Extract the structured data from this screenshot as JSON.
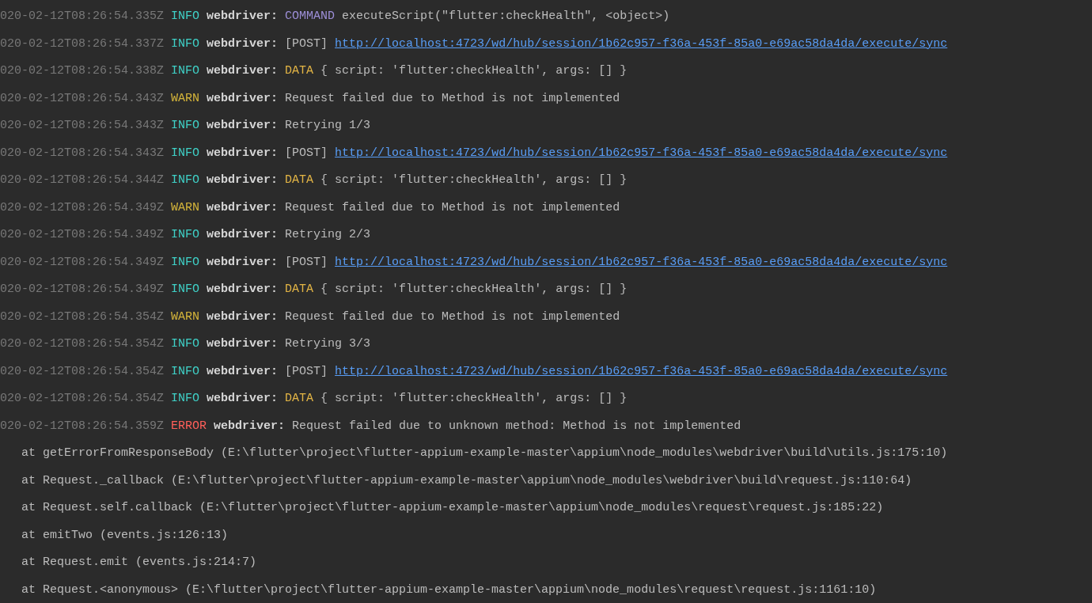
{
  "console": {
    "lines": [
      {
        "kind": "info",
        "timestamp": "020-02-12T08:26:54.335Z",
        "severity": "INFO",
        "source": "webdriver:",
        "message": [
          {
            "kind": "command",
            "text": "COMMAND"
          },
          {
            "kind": "text",
            "text": "executeScript(\"flutter:checkHealth\", <object>)"
          }
        ]
      },
      {
        "kind": "info",
        "timestamp": "020-02-12T08:26:54.337Z",
        "severity": "INFO",
        "source": "webdriver:",
        "message": [
          {
            "kind": "text",
            "text": "[POST]"
          },
          {
            "kind": "link",
            "text": "http://localhost:4723/wd/hub/session/1b62c957-f36a-453f-85a0-e69ac58da4da/execute/sync"
          }
        ]
      },
      {
        "kind": "info",
        "timestamp": "020-02-12T08:26:54.338Z",
        "severity": "INFO",
        "source": "webdriver:",
        "message": [
          {
            "kind": "data",
            "text": "DATA"
          },
          {
            "kind": "text",
            "text": "{ script: 'flutter:checkHealth', args: [] }"
          }
        ]
      },
      {
        "kind": "warn",
        "timestamp": "020-02-12T08:26:54.343Z",
        "severity": "WARN",
        "source": "webdriver:",
        "message": [
          {
            "kind": "text",
            "text": "Request failed due to Method is not implemented"
          }
        ]
      },
      {
        "kind": "info",
        "timestamp": "020-02-12T08:26:54.343Z",
        "severity": "INFO",
        "source": "webdriver:",
        "message": [
          {
            "kind": "text",
            "text": "Retrying 1/3"
          }
        ]
      },
      {
        "kind": "info",
        "timestamp": "020-02-12T08:26:54.343Z",
        "severity": "INFO",
        "source": "webdriver:",
        "message": [
          {
            "kind": "text",
            "text": "[POST]"
          },
          {
            "kind": "link",
            "text": "http://localhost:4723/wd/hub/session/1b62c957-f36a-453f-85a0-e69ac58da4da/execute/sync"
          }
        ]
      },
      {
        "kind": "info",
        "timestamp": "020-02-12T08:26:54.344Z",
        "severity": "INFO",
        "source": "webdriver:",
        "message": [
          {
            "kind": "data",
            "text": "DATA"
          },
          {
            "kind": "text",
            "text": "{ script: 'flutter:checkHealth', args: [] }"
          }
        ]
      },
      {
        "kind": "warn",
        "timestamp": "020-02-12T08:26:54.349Z",
        "severity": "WARN",
        "source": "webdriver:",
        "message": [
          {
            "kind": "text",
            "text": "Request failed due to Method is not implemented"
          }
        ]
      },
      {
        "kind": "info",
        "timestamp": "020-02-12T08:26:54.349Z",
        "severity": "INFO",
        "source": "webdriver:",
        "message": [
          {
            "kind": "text",
            "text": "Retrying 2/3"
          }
        ]
      },
      {
        "kind": "info",
        "timestamp": "020-02-12T08:26:54.349Z",
        "severity": "INFO",
        "source": "webdriver:",
        "message": [
          {
            "kind": "text",
            "text": "[POST]"
          },
          {
            "kind": "link",
            "text": "http://localhost:4723/wd/hub/session/1b62c957-f36a-453f-85a0-e69ac58da4da/execute/sync"
          }
        ]
      },
      {
        "kind": "info",
        "timestamp": "020-02-12T08:26:54.349Z",
        "severity": "INFO",
        "source": "webdriver:",
        "message": [
          {
            "kind": "data",
            "text": "DATA"
          },
          {
            "kind": "text",
            "text": "{ script: 'flutter:checkHealth', args: [] }"
          }
        ]
      },
      {
        "kind": "warn",
        "timestamp": "020-02-12T08:26:54.354Z",
        "severity": "WARN",
        "source": "webdriver:",
        "message": [
          {
            "kind": "text",
            "text": "Request failed due to Method is not implemented"
          }
        ]
      },
      {
        "kind": "info",
        "timestamp": "020-02-12T08:26:54.354Z",
        "severity": "INFO",
        "source": "webdriver:",
        "message": [
          {
            "kind": "text",
            "text": "Retrying 3/3"
          }
        ]
      },
      {
        "kind": "info",
        "timestamp": "020-02-12T08:26:54.354Z",
        "severity": "INFO",
        "source": "webdriver:",
        "message": [
          {
            "kind": "text",
            "text": "[POST]"
          },
          {
            "kind": "link",
            "text": "http://localhost:4723/wd/hub/session/1b62c957-f36a-453f-85a0-e69ac58da4da/execute/sync"
          }
        ]
      },
      {
        "kind": "info",
        "timestamp": "020-02-12T08:26:54.354Z",
        "severity": "INFO",
        "source": "webdriver:",
        "message": [
          {
            "kind": "data",
            "text": "DATA"
          },
          {
            "kind": "text",
            "text": "{ script: 'flutter:checkHealth', args: [] }"
          }
        ]
      },
      {
        "kind": "error",
        "timestamp": "020-02-12T08:26:54.359Z",
        "severity": "ERROR",
        "source": "webdriver:",
        "message": [
          {
            "kind": "text",
            "text": "Request failed due to unknown method: Method is not implemented"
          }
        ]
      },
      {
        "kind": "trace",
        "text": "at getErrorFromResponseBody (E:\\flutter\\project\\flutter-appium-example-master\\appium\\node_modules\\webdriver\\build\\utils.js:175:10)"
      },
      {
        "kind": "trace",
        "text": "at Request._callback (E:\\flutter\\project\\flutter-appium-example-master\\appium\\node_modules\\webdriver\\build\\request.js:110:64)"
      },
      {
        "kind": "trace",
        "text": "at Request.self.callback (E:\\flutter\\project\\flutter-appium-example-master\\appium\\node_modules\\request\\request.js:185:22)"
      },
      {
        "kind": "trace",
        "text": "at emitTwo (events.js:126:13)"
      },
      {
        "kind": "trace",
        "text": "at Request.emit (events.js:214:7)"
      },
      {
        "kind": "trace",
        "text": "at Request.<anonymous> (E:\\flutter\\project\\flutter-appium-example-master\\appium\\node_modules\\request\\request.js:1161:10)"
      }
    ]
  }
}
